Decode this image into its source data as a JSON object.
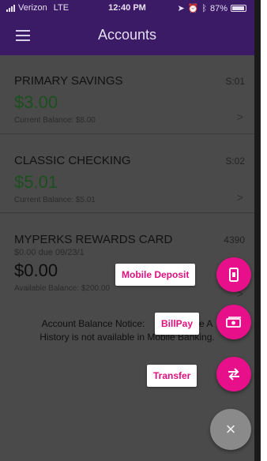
{
  "status_bar": {
    "carrier": "Verizon",
    "network": "LTE",
    "time": "12:40 PM",
    "battery": "87%"
  },
  "header": {
    "title": "Accounts",
    "menu_icon": "hamburger-menu-icon"
  },
  "accounts": [
    {
      "name": "PRIMARY SAVINGS",
      "code": "S:01",
      "amount": "$3.00",
      "detail": "Current Balance: $8.00"
    },
    {
      "name": "CLASSIC CHECKING",
      "code": "S:02",
      "amount": "$5.01",
      "detail": "Current Balance: $5.01"
    },
    {
      "name": "MYPERKS REWARDS CARD",
      "code": "4390",
      "due": "$0.00 due 09/23/1",
      "amount": "$0.00",
      "detail": "Available Balance: $200.00"
    }
  ],
  "notice": {
    "line1_start": "Account Balance Notice:",
    "line1_end": "e A",
    "line2": "History is not available in Mobile Banking."
  },
  "fab_menu": {
    "mobile_deposit_label": "Mobile Deposit",
    "billpay_label": "BillPay",
    "transfer_label": "Transfer",
    "accent_color": "#e8108a"
  }
}
